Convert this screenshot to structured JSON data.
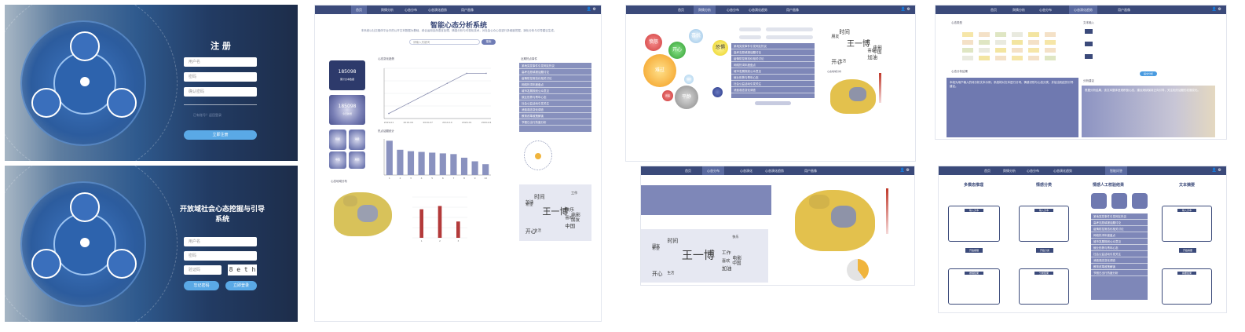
{
  "login_register": {
    "title": "注 册",
    "inputs": [
      "用户名",
      "密码",
      "确认密码"
    ],
    "link_text": "已有账号？返回登录",
    "button": "立即注册"
  },
  "login_main": {
    "title": "开放域社会心态挖掘与引导系统",
    "inputs": [
      "用户名",
      "密码",
      "验证码"
    ],
    "captcha": "8 e t h",
    "buttons": [
      "忘记密码",
      "立即登录"
    ]
  },
  "screen_home": {
    "nav": [
      "首页",
      "舆情分析",
      "心态分布",
      "心态演化趋势",
      "用户画像"
    ],
    "title": "智能心态分析系统",
    "intro": "本系统以社交媒体平台中的公开文本数据为基础，综合运用自然语言处理、情感分析与可视化技术，对社会公众心态进行多维度挖掘、演化分析与引导建议生成。",
    "search_placeholder": "请输入关键词",
    "search_button": "搜索",
    "cards": [
      {
        "value": "185098",
        "label": "累计文本数据"
      },
      {
        "value": "185098",
        "label": "今日新增"
      },
      {
        "value": "",
        "label": "积极"
      },
      {
        "value": "",
        "label": "消极"
      },
      {
        "value": "",
        "label": "中性"
      },
      {
        "value": "",
        "label": "其他"
      }
    ],
    "line_title": "心态变化趋势",
    "bar_title": "热点话题统计",
    "map_title": "心态地域分布",
    "list_title": "近期热点事件",
    "list_items": [
      "某地突发事件引发网友热议",
      "高考志愿填报话题讨论",
      "疫情防控常态化相关讨论",
      "网络热词年度盘点",
      "城市发展规划公众意见",
      "就业形势与青年心态",
      "社会公益活动引发关注",
      "消费观念变化调查",
      "教育改革政策解读",
      "节假日出行热度分析"
    ],
    "words": [
      "王一博",
      "电影",
      "喜欢",
      "开心",
      "生活",
      "朋友",
      "中国",
      "加油",
      "时间",
      "工作",
      "快乐",
      "希望"
    ]
  },
  "chart_data": [
    {
      "type": "line",
      "x": [
        "2019-01",
        "2019-04",
        "2019-07",
        "2019-10",
        "2020-01",
        "2020-04"
      ],
      "series": [
        {
          "values": [
            10,
            30,
            50,
            70,
            90,
            90
          ]
        }
      ],
      "ylim": [
        0,
        100
      ]
    },
    {
      "type": "bar",
      "categories": [
        "1",
        "2",
        "3",
        "4",
        "5",
        "6",
        "7",
        "8",
        "9",
        "10"
      ],
      "values": [
        95,
        70,
        66,
        64,
        62,
        60,
        58,
        48,
        38,
        30
      ],
      "ylim": [
        0,
        100
      ]
    },
    {
      "type": "bar",
      "categories": [
        "1",
        "2",
        "3"
      ],
      "values": [
        70,
        78,
        40
      ],
      "ylim": [
        0,
        100
      ]
    }
  ],
  "screen_bubbles": {
    "nav": [
      "首页",
      "舆情分析",
      "心态分布",
      "心态演化趋势",
      "用户画像"
    ],
    "bubbles": [
      "愤怒",
      "难过",
      "开心",
      "喜悦",
      "恐惧",
      "惊讶",
      "厌恶",
      "平静"
    ],
    "map_title": "心态地域分布",
    "words": [
      "王一博",
      "电影",
      "喜欢",
      "开心",
      "生活",
      "中国",
      "加油",
      "朋友",
      "时间"
    ]
  },
  "screen_map": {
    "nav": [
      "首页",
      "心态分布",
      "心态演化",
      "心态演化趋势",
      "用户画像"
    ],
    "words": [
      "王一博",
      "电影",
      "喜欢",
      "开心",
      "生活",
      "中国",
      "加油",
      "朋友",
      "时间",
      "快乐",
      "工作",
      "希望"
    ]
  },
  "screen_analysis": {
    "nav": [
      "首页",
      "舆情分析",
      "心态分布",
      "心态演化趋势",
      "用户画像"
    ],
    "left_title": "心态类型",
    "right_title": "文本输入",
    "text_title": "心态分析结果",
    "result_title": "分析建议",
    "submit": "提交分析",
    "paragraph": "本段为用户输入的待分析文本示例，系统将对文本进行分词、情感识别与心态分类，并给出相应的引导建议。",
    "result_paragraph": "根据分析结果，该文本整体呈现积极心态，建议继续保持正向引导，关注相关话题的发展变化。"
  },
  "screen_dialog": {
    "nav": [
      "首页",
      "舆情分析",
      "心态分布",
      "心态演化趋势",
      "智能问答"
    ],
    "sections": [
      "多模态推理",
      "情感分类",
      "情感人工校验结果",
      "文本摘要"
    ],
    "box_labels": [
      "输入文本",
      "输入文本",
      "输入文本"
    ],
    "buttons": [
      "开始推理",
      "开始分类",
      "开始摘要"
    ],
    "out_labels": [
      "推理结果",
      "分类结果",
      "摘要结果"
    ]
  }
}
